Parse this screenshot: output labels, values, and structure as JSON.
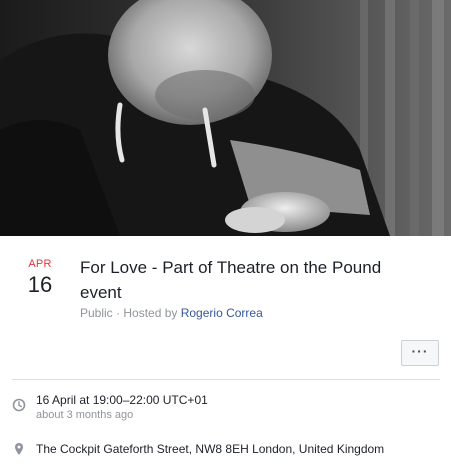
{
  "event": {
    "month": "APR",
    "day": "16",
    "title": "For Love - Part of Theatre on the Pound event",
    "visibility": "Public · Hosted by ",
    "host": "Rogerio Correa",
    "more_label": "···"
  },
  "details": {
    "time_main": "16 April at 19:00–22:00 UTC+01",
    "time_relative": "about 3 months ago",
    "location": "The Cockpit Gateforth Street, NW8 8EH London, United Kingdom"
  },
  "icons": {
    "time": "clock-icon",
    "location": "map-pin-icon",
    "more": "more-dots-icon"
  },
  "colors": {
    "accent_red": "#e4333a",
    "link_blue": "#365899",
    "muted": "#90949c"
  }
}
